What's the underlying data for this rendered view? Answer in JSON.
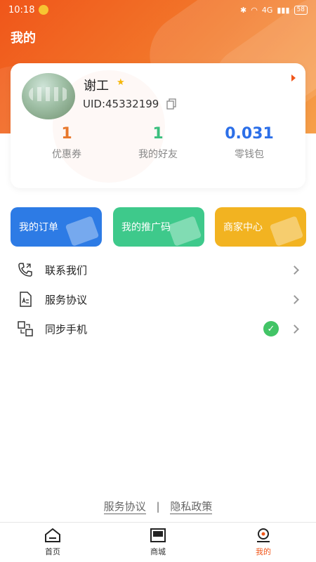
{
  "status_bar": {
    "time": "10:18",
    "signal_text": "4G",
    "battery": "58"
  },
  "header": {
    "title": "我的"
  },
  "profile": {
    "name": "谢工",
    "uid": "UID:45332199",
    "stats": [
      {
        "value": "1",
        "label": "优惠券"
      },
      {
        "value": "1",
        "label": "我的好友"
      },
      {
        "value": "0.031",
        "label": "零钱包"
      }
    ]
  },
  "tiles": [
    {
      "label": "我的订单"
    },
    {
      "label": "我的推广码"
    },
    {
      "label": "商家中心"
    }
  ],
  "menu": [
    {
      "label": "联系我们",
      "icon": "phone-icon"
    },
    {
      "label": "服务协议",
      "icon": "document-icon"
    },
    {
      "label": "同步手机",
      "icon": "sync-icon",
      "checked": true
    }
  ],
  "footer": {
    "service": "服务协议",
    "separator": "|",
    "privacy": "隐私政策"
  },
  "bottom_nav": [
    {
      "label": "首页",
      "icon": "home-icon"
    },
    {
      "label": "商城",
      "icon": "store-icon"
    },
    {
      "label": "我的",
      "icon": "profile-icon",
      "active": true
    }
  ],
  "colors": {
    "accent": "#f0561a",
    "blue": "#2d7be5",
    "green": "#3ec98b",
    "yellow": "#f2b321"
  }
}
